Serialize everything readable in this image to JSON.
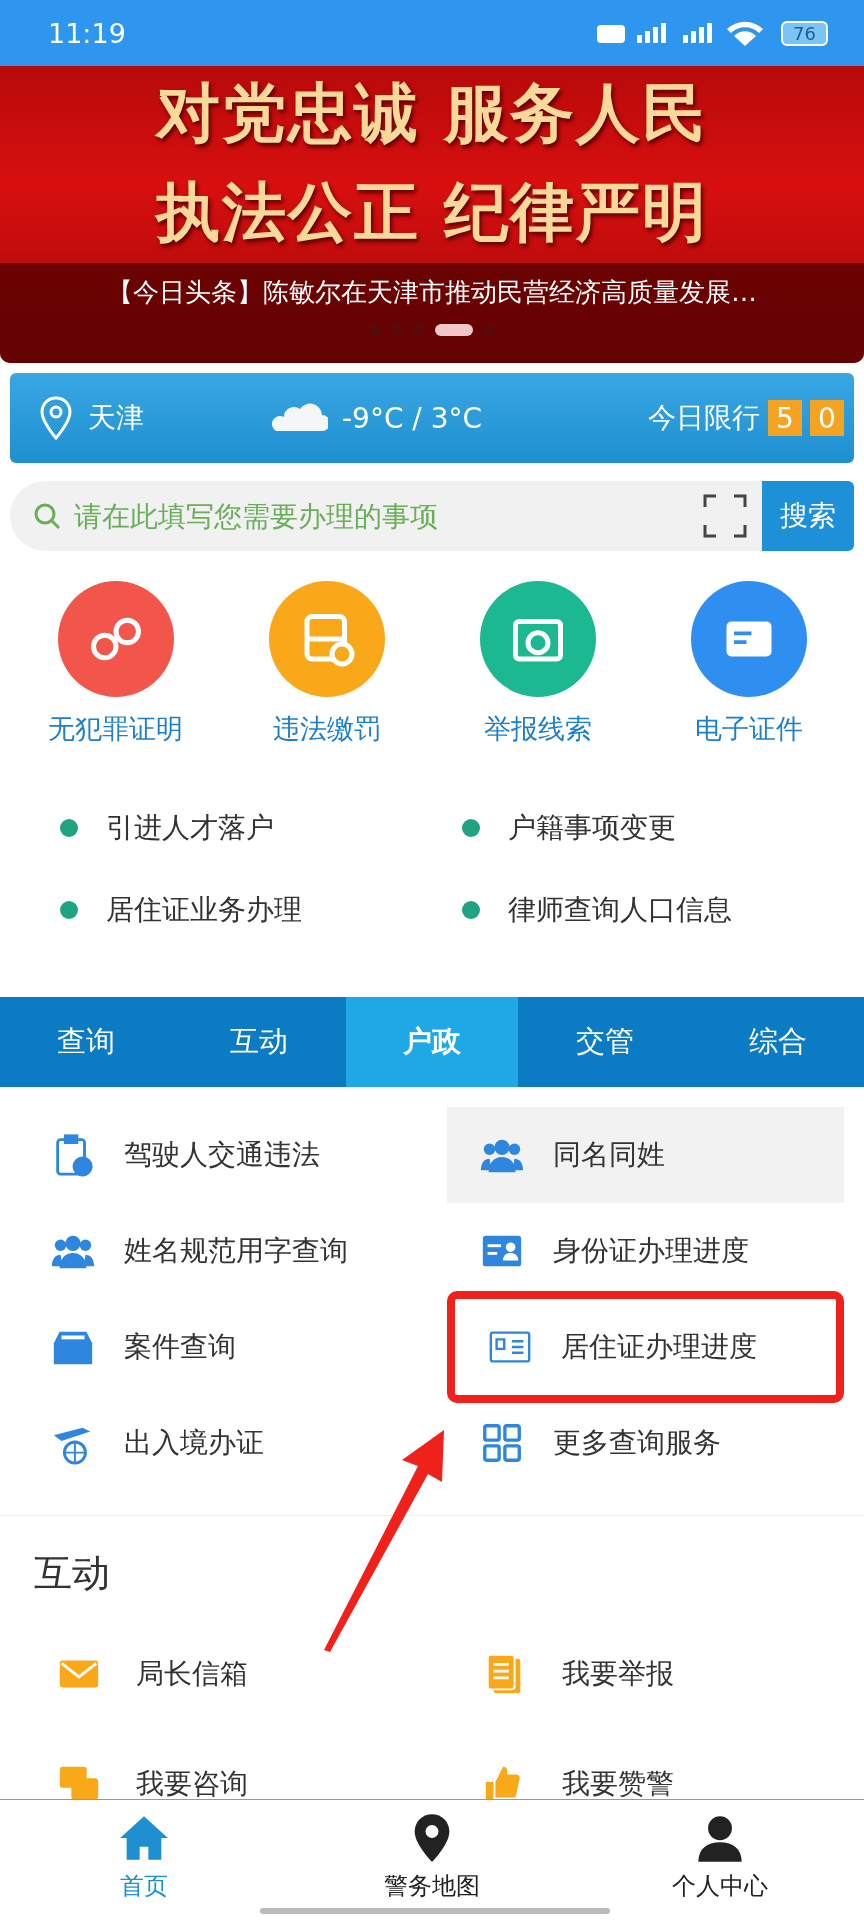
{
  "status_bar": {
    "time": "11:19",
    "battery": "76"
  },
  "banner": {
    "slogans": [
      "对党忠诚  服务人民",
      "执法公正  纪律严明"
    ],
    "headline": "【今日头条】陈敏尔在天津市推动民营经济高质量发展…",
    "dots": [
      {
        "selected": false
      },
      {
        "selected": false
      },
      {
        "selected": false
      },
      {
        "selected": true
      },
      {
        "selected": false
      }
    ]
  },
  "weather": {
    "city": "天津",
    "temperature": "-9°C / 3°C",
    "restriction_label": "今日限行",
    "restriction_digits": [
      "5",
      "0"
    ]
  },
  "search": {
    "placeholder": "请在此填写您需要办理的事项",
    "button": "搜索"
  },
  "quick_services": [
    {
      "label": "无犯罪证明",
      "color": "#f2564b"
    },
    {
      "label": "违法缴罚",
      "color": "#f9a81a"
    },
    {
      "label": "举报线索",
      "color": "#1cb892"
    },
    {
      "label": "电子证件",
      "color": "#2e8ff0"
    }
  ],
  "bullet_links": [
    "引进人才落户",
    "户籍事项变更",
    "居住证业务办理",
    "律师查询人口信息"
  ],
  "tabs": [
    {
      "label": "查询",
      "selected": false
    },
    {
      "label": "互动",
      "selected": false
    },
    {
      "label": "户政",
      "selected": true
    },
    {
      "label": "交管",
      "selected": false
    },
    {
      "label": "综合",
      "selected": false
    }
  ],
  "tab_items": [
    {
      "label": "驾驶人交通违法",
      "pressed": false
    },
    {
      "label": "同名同姓",
      "pressed": true
    },
    {
      "label": "姓名规范用字查询",
      "pressed": false
    },
    {
      "label": "身份证办理进度",
      "pressed": false
    },
    {
      "label": "案件查询",
      "pressed": false
    },
    {
      "label": "居住证办理进度",
      "pressed": false,
      "annotated": true
    },
    {
      "label": "出入境办证",
      "pressed": false
    },
    {
      "label": "更多查询服务",
      "pressed": false
    }
  ],
  "interaction": {
    "title": "互动",
    "items": [
      "局长信箱",
      "我要举报",
      "我要咨询",
      "我要赞警"
    ]
  },
  "bottom_nav": [
    {
      "label": "首页",
      "selected": true
    },
    {
      "label": "警务地图",
      "selected": false
    },
    {
      "label": "个人中心",
      "selected": false
    }
  ]
}
